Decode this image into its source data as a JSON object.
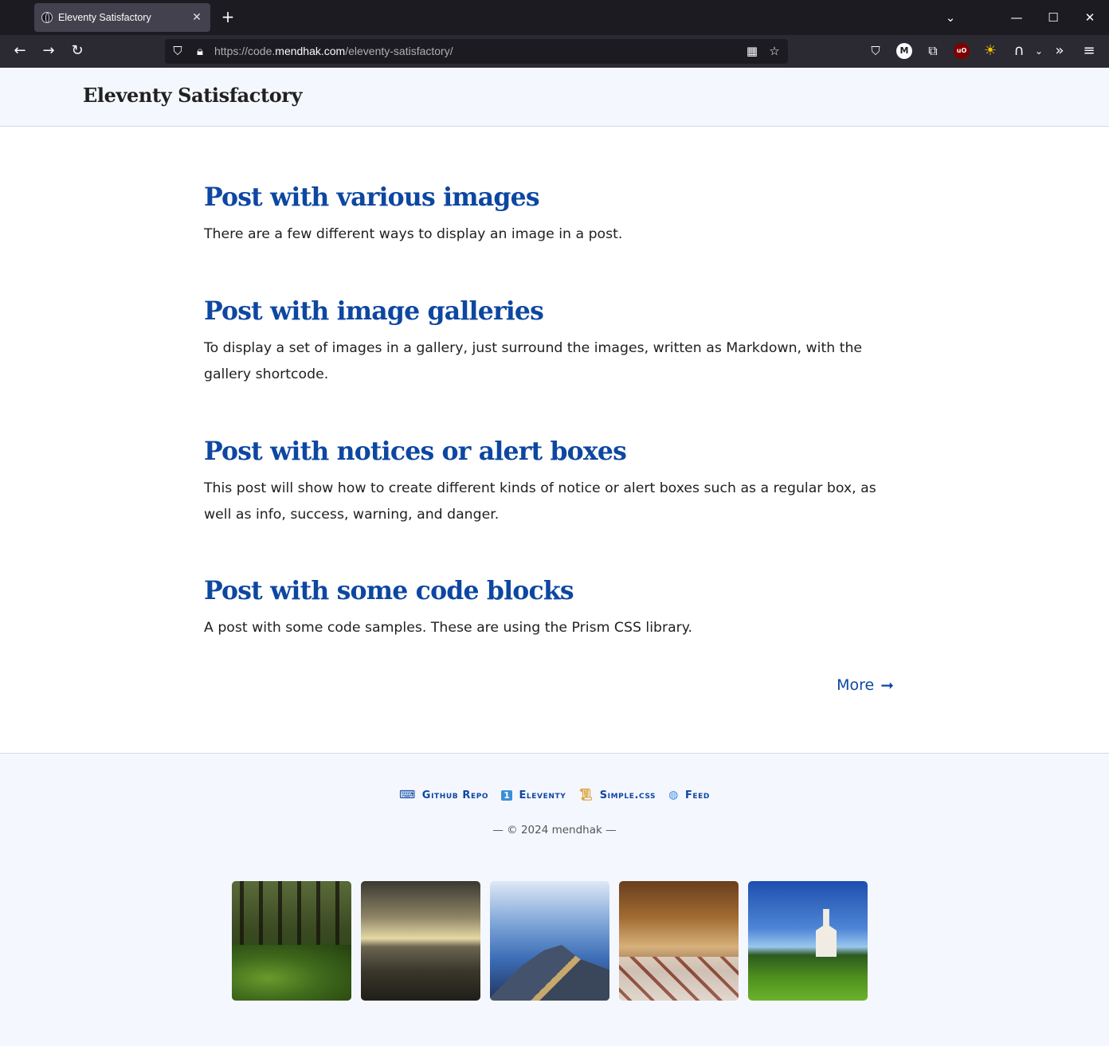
{
  "browser": {
    "tab_title": "Eleventy Satisfactory",
    "url_prefix": "https://code.",
    "url_domain": "mendhak.com",
    "url_path": "/eleventy-satisfactory/"
  },
  "site": {
    "title": "Eleventy Satisfactory"
  },
  "posts": [
    {
      "title": "Post with various images",
      "description": "There are a few different ways to display an image in a post."
    },
    {
      "title": "Post with image galleries",
      "description": "To display a set of images in a gallery, just surround the images, written as Markdown, with the gallery shortcode."
    },
    {
      "title": "Post with notices or alert boxes",
      "description": "This post will show how to create different kinds of notice or alert boxes such as a regular box, as well as info, success, warning, and danger."
    },
    {
      "title": "Post with some code blocks",
      "description": "A post with some code samples. These are using the Prism CSS library."
    }
  ],
  "more": {
    "label": "More"
  },
  "footer": {
    "links": [
      {
        "label": "Github Repo",
        "icon": "keyboard-icon"
      },
      {
        "label": "Eleventy",
        "icon": "keycap-one-icon"
      },
      {
        "label": "Simple.css",
        "icon": "scroll-icon"
      },
      {
        "label": "Feed",
        "icon": "globe-icon"
      }
    ],
    "copyright": "— © 2024 mendhak —"
  },
  "colors": {
    "link": "#0d47a1",
    "header_bg": "#f5f7ff",
    "text": "#212121"
  }
}
